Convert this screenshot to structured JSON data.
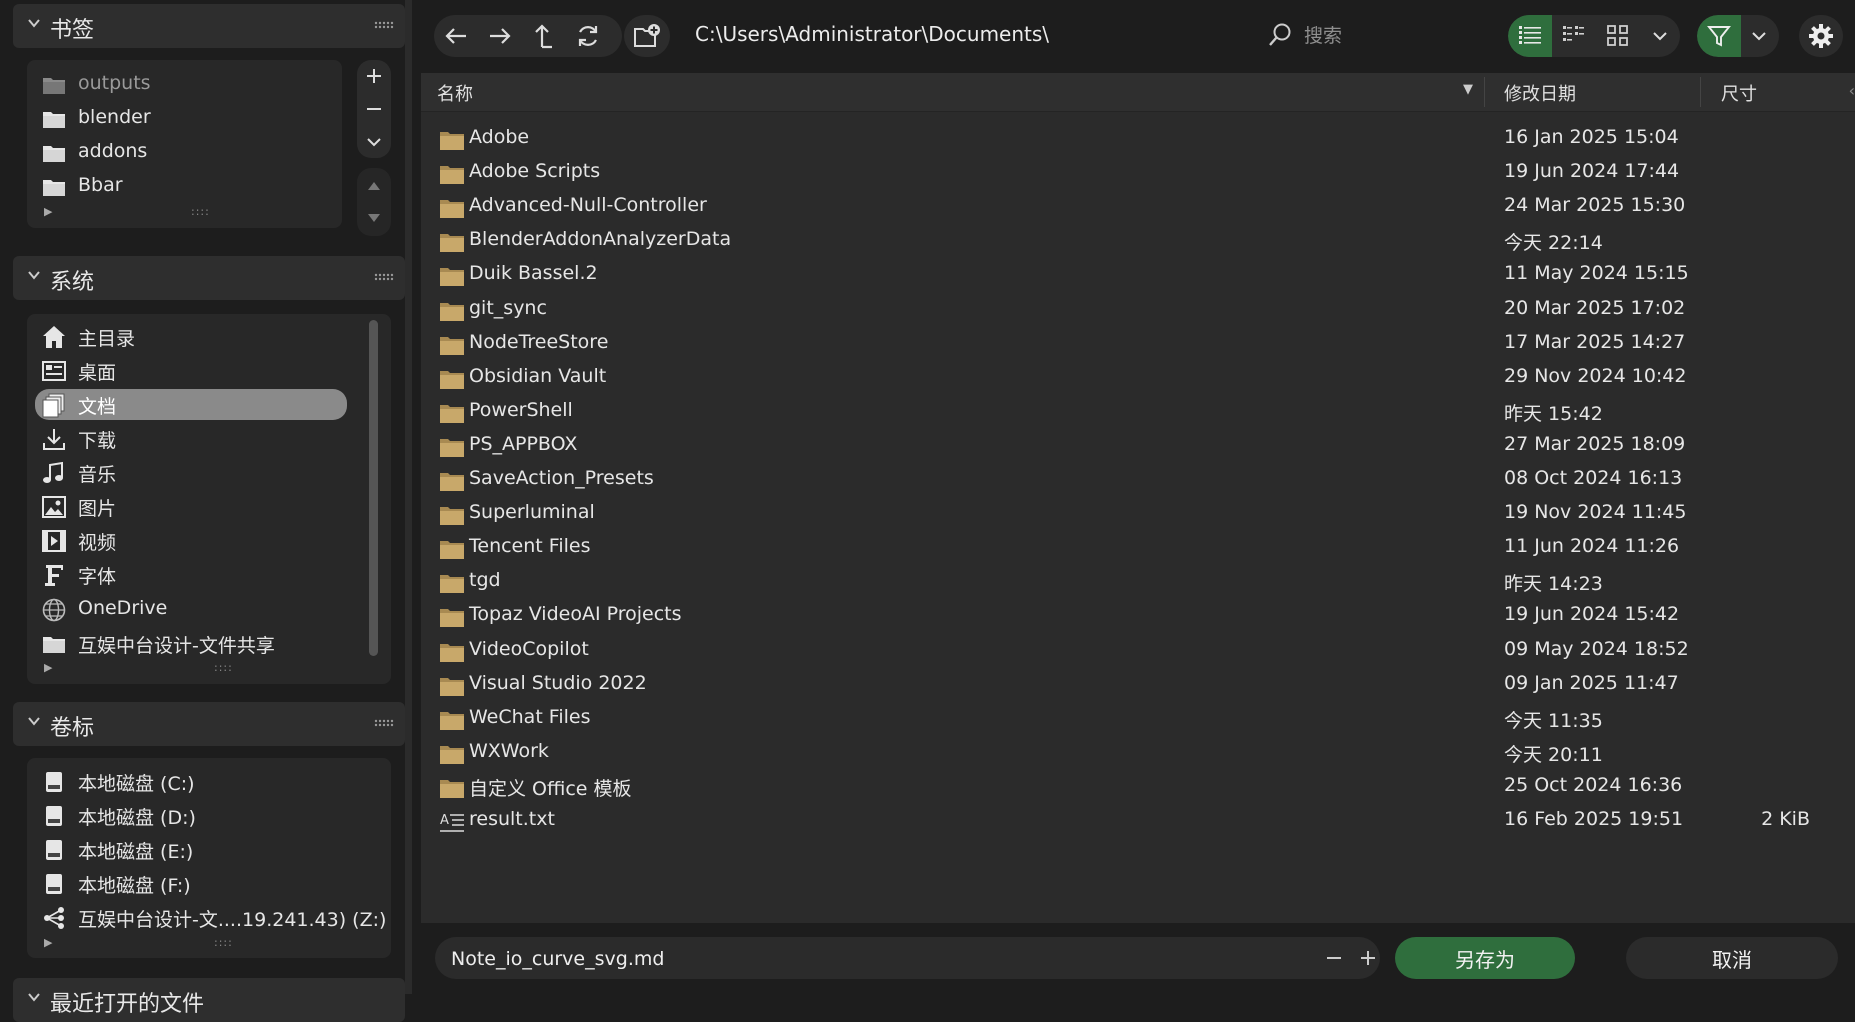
{
  "colors": {
    "accent_green": "#2f6e3d",
    "folder": "#c8a86a",
    "active_item": "#8a8a8a",
    "panel_bg": "#282828"
  },
  "sidebar": {
    "bookmarks": {
      "title": "书签",
      "items": [
        {
          "label": "outputs",
          "icon": "folder-icon"
        },
        {
          "label": "blender",
          "icon": "folder-icon"
        },
        {
          "label": "addons",
          "icon": "folder-icon"
        },
        {
          "label": "Bbar",
          "icon": "folder-icon"
        }
      ]
    },
    "system": {
      "title": "系统",
      "items": [
        {
          "label": "主目录",
          "icon": "home-icon"
        },
        {
          "label": "桌面",
          "icon": "desktop-icon"
        },
        {
          "label": "文档",
          "icon": "documents-icon"
        },
        {
          "label": "下载",
          "icon": "download-icon"
        },
        {
          "label": "音乐",
          "icon": "music-icon"
        },
        {
          "label": "图片",
          "icon": "image-icon"
        },
        {
          "label": "视频",
          "icon": "video-icon"
        },
        {
          "label": "字体",
          "icon": "font-icon"
        },
        {
          "label": "OneDrive",
          "icon": "globe-icon"
        },
        {
          "label": "互娱中台设计-文件共享",
          "icon": "folder-icon"
        }
      ]
    },
    "volumes": {
      "title": "卷标",
      "items": [
        {
          "label": "本地磁盘 (C:)",
          "icon": "disk-icon"
        },
        {
          "label": "本地磁盘 (D:)",
          "icon": "disk-icon"
        },
        {
          "label": "本地磁盘 (E:)",
          "icon": "disk-icon"
        },
        {
          "label": "本地磁盘 (F:)",
          "icon": "disk-icon"
        },
        {
          "label": "互娱中台设计-文....19.241.43) (Z:)",
          "icon": "network-icon"
        }
      ]
    },
    "recent": {
      "title": "最近打开的文件"
    }
  },
  "toolbar": {
    "path": "C:\\Users\\Administrator\\Documents\\",
    "search_placeholder": "搜索"
  },
  "filelist": {
    "columns": {
      "name": "名称",
      "date": "修改日期",
      "size": "尺寸"
    },
    "rows": [
      {
        "name": "Adobe",
        "date": "16 Jan 2025 15:04",
        "size": "",
        "type": "folder"
      },
      {
        "name": "Adobe Scripts",
        "date": "19 Jun 2024 17:44",
        "size": "",
        "type": "folder"
      },
      {
        "name": "Advanced-Null-Controller",
        "date": "24 Mar 2025 15:30",
        "size": "",
        "type": "folder"
      },
      {
        "name": "BlenderAddonAnalyzerData",
        "date": "今天 22:14",
        "size": "",
        "type": "folder"
      },
      {
        "name": "Duik Bassel.2",
        "date": "11 May 2024 15:15",
        "size": "",
        "type": "folder"
      },
      {
        "name": "git_sync",
        "date": "20 Mar 2025 17:02",
        "size": "",
        "type": "folder"
      },
      {
        "name": "NodeTreeStore",
        "date": "17 Mar 2025 14:27",
        "size": "",
        "type": "folder"
      },
      {
        "name": "Obsidian Vault",
        "date": "29 Nov 2024 10:42",
        "size": "",
        "type": "folder"
      },
      {
        "name": "PowerShell",
        "date": "昨天 15:42",
        "size": "",
        "type": "folder"
      },
      {
        "name": "PS_APPBOX",
        "date": "27 Mar 2025 18:09",
        "size": "",
        "type": "folder"
      },
      {
        "name": "SaveAction_Presets",
        "date": "08 Oct 2024 16:13",
        "size": "",
        "type": "folder"
      },
      {
        "name": "Superluminal",
        "date": "19 Nov 2024 11:45",
        "size": "",
        "type": "folder"
      },
      {
        "name": "Tencent Files",
        "date": "11 Jun 2024 11:26",
        "size": "",
        "type": "folder"
      },
      {
        "name": "tgd",
        "date": "昨天 14:23",
        "size": "",
        "type": "folder"
      },
      {
        "name": "Topaz VideoAI Projects",
        "date": "19 Jun 2024 15:42",
        "size": "",
        "type": "folder"
      },
      {
        "name": "VideoCopilot",
        "date": "09 May 2024 18:52",
        "size": "",
        "type": "folder"
      },
      {
        "name": "Visual Studio 2022",
        "date": "09 Jan 2025 11:47",
        "size": "",
        "type": "folder"
      },
      {
        "name": "WeChat Files",
        "date": "今天 11:35",
        "size": "",
        "type": "folder"
      },
      {
        "name": "WXWork",
        "date": "今天 20:11",
        "size": "",
        "type": "folder"
      },
      {
        "name": "自定义 Office 模板",
        "date": "25 Oct 2024 16:36",
        "size": "",
        "type": "folder"
      },
      {
        "name": "result.txt",
        "date": "16 Feb 2025 19:51",
        "size": "2 KiB",
        "type": "text-file"
      }
    ]
  },
  "bottom": {
    "filename": "Note_io_curve_svg.md",
    "save_label": "另存为",
    "cancel_label": "取消"
  }
}
